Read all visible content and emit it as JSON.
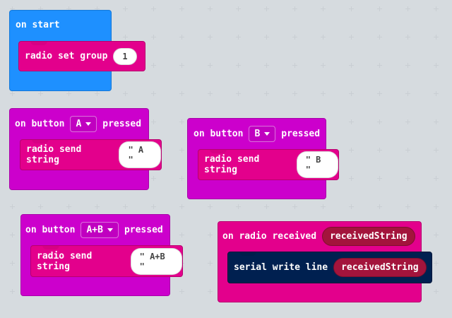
{
  "blocks": {
    "on_start": {
      "label": "on start",
      "stmt_label": "radio set group",
      "value": "1"
    },
    "button_a": {
      "prefix": "on button",
      "button": "A",
      "suffix": "pressed",
      "stmt_label": "radio send string",
      "value": "\" A \""
    },
    "button_b": {
      "prefix": "on button",
      "button": "B",
      "suffix": "pressed",
      "stmt_label": "radio send string",
      "value": "\" B \""
    },
    "button_ab": {
      "prefix": "on button",
      "button": "A+B",
      "suffix": "pressed",
      "stmt_label": "radio send string",
      "value": "\" A+B \""
    },
    "radio_received": {
      "label": "on radio received",
      "variable": "receivedString",
      "stmt_label": "serial write line",
      "stmt_value": "receivedString"
    }
  },
  "colors": {
    "background": "#eceff1",
    "on_start": "#1e90ff",
    "event": "#cc00cc",
    "radio": "#e3008c",
    "serial": "#002050",
    "variable": "#a3143c"
  },
  "icons": {
    "dropdown": "caret-down-icon"
  }
}
